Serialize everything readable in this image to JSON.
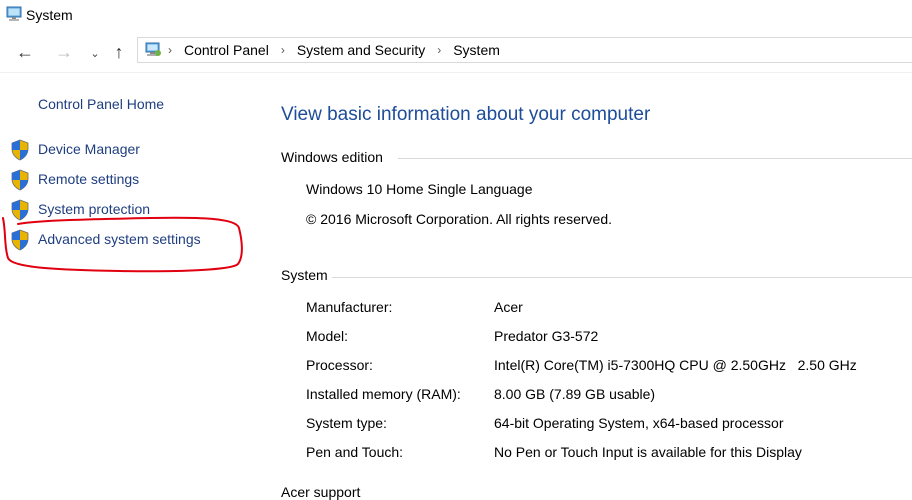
{
  "window": {
    "title": "System"
  },
  "nav": {
    "back_glyph": "←",
    "forward_glyph": "→",
    "recent_glyph": "⌄",
    "up_glyph": "↑",
    "separator": "›",
    "breadcrumbs": [
      "Control Panel",
      "System and Security",
      "System"
    ]
  },
  "sidebar": {
    "home": "Control Panel Home",
    "items": [
      {
        "label": "Device Manager",
        "icon": "shield-icon"
      },
      {
        "label": "Remote settings",
        "icon": "shield-icon"
      },
      {
        "label": "System protection",
        "icon": "shield-icon"
      },
      {
        "label": "Advanced system settings",
        "icon": "shield-icon"
      }
    ]
  },
  "main": {
    "title": "View basic information about your computer",
    "windows_edition": {
      "heading": "Windows edition",
      "name": "Windows 10 Home Single Language",
      "copyright": "© 2016 Microsoft Corporation. All rights reserved."
    },
    "system": {
      "heading": "System",
      "rows": [
        {
          "label": "Manufacturer:",
          "value": "Acer"
        },
        {
          "label": "Model:",
          "value": "Predator G3-572"
        },
        {
          "label": "Processor:",
          "value": "Intel(R) Core(TM) i5-7300HQ CPU @ 2.50GHz   2.50 GHz"
        },
        {
          "label": "Installed memory (RAM):",
          "value": "8.00 GB (7.89 GB usable)"
        },
        {
          "label": "System type:",
          "value": "64-bit Operating System, x64-based processor"
        },
        {
          "label": "Pen and Touch:",
          "value": "No Pen or Touch Input is available for this Display"
        }
      ]
    },
    "acer_support": {
      "heading": "Acer support"
    }
  },
  "colors": {
    "link": "#1f3e80",
    "title": "#1d4d99",
    "annotation": "#e0000f"
  }
}
